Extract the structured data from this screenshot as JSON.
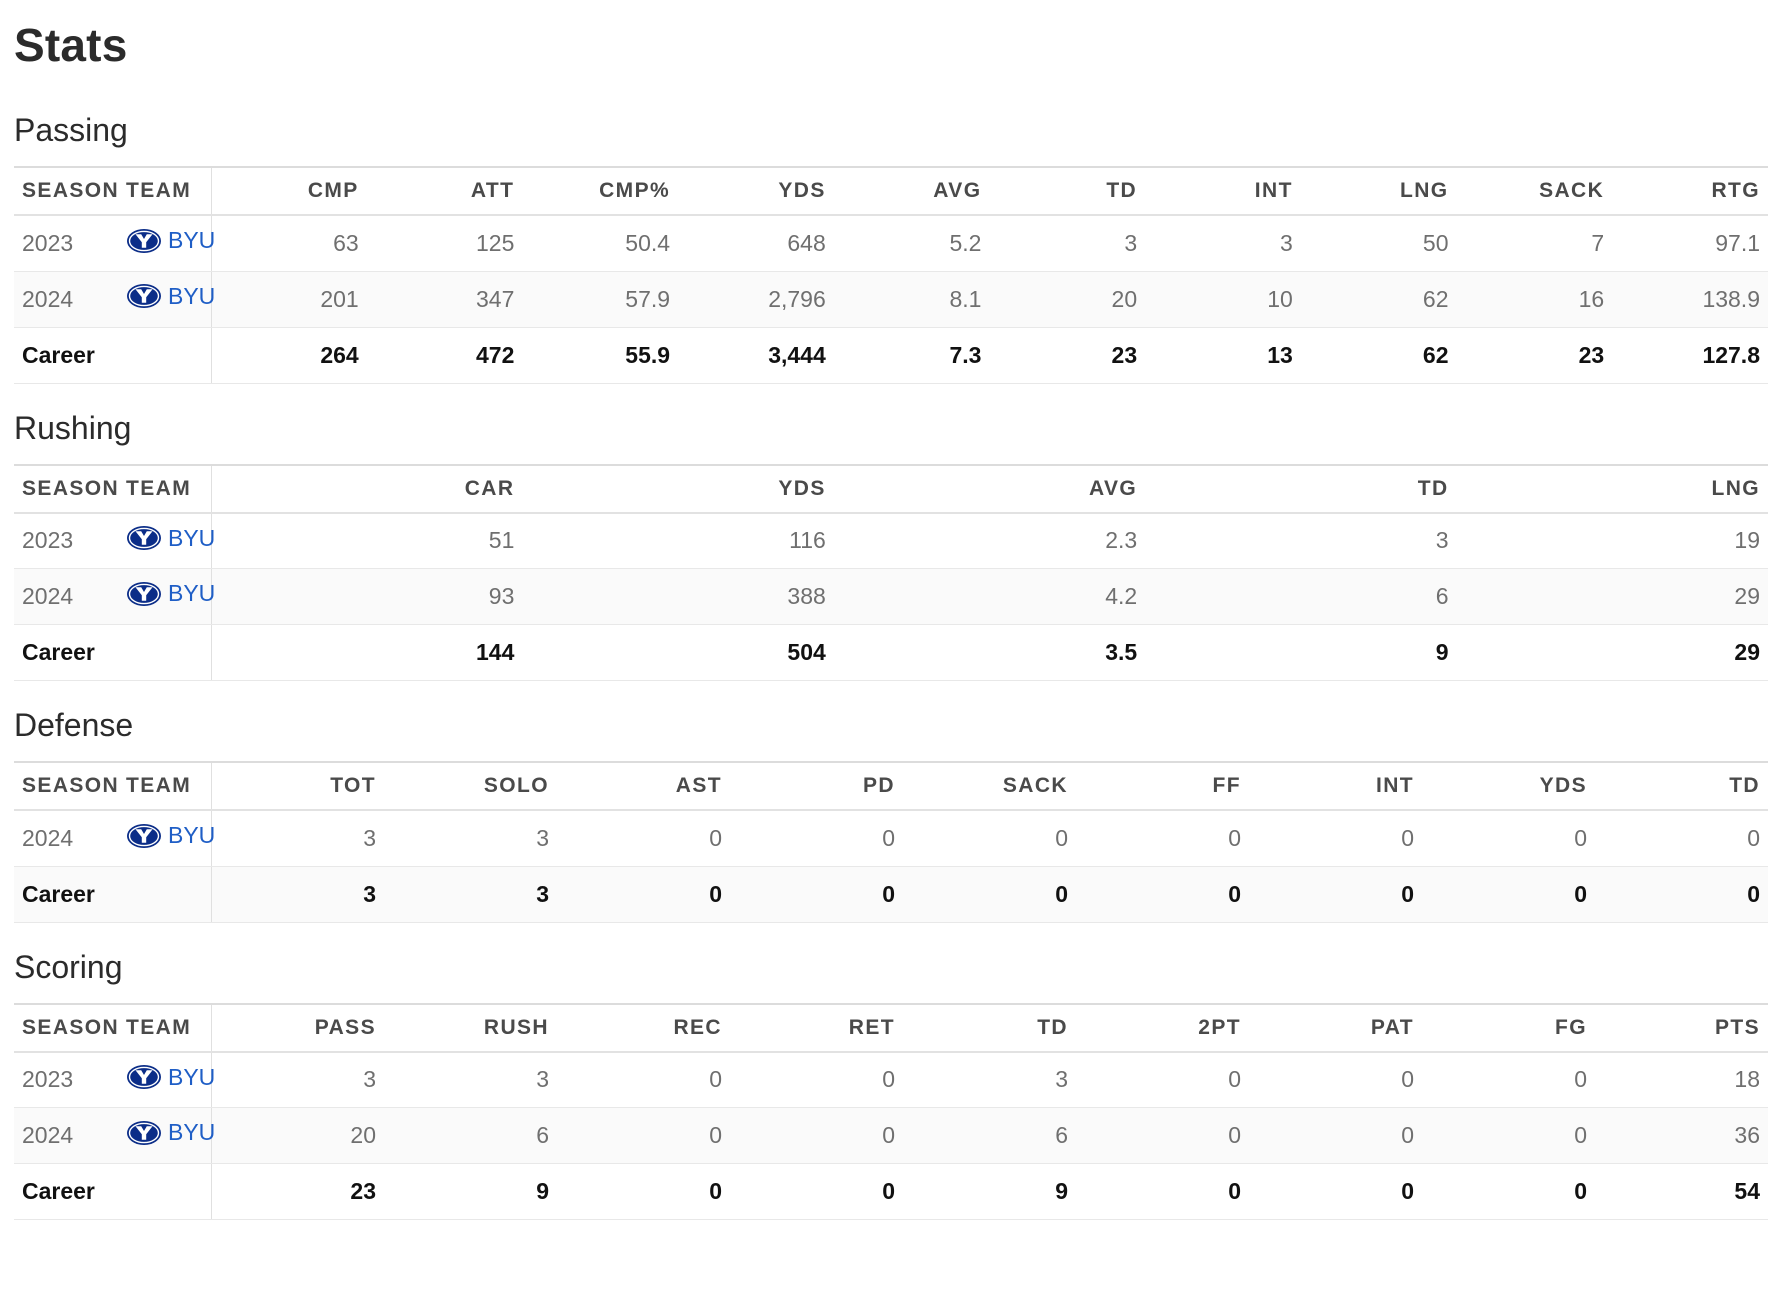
{
  "page": {
    "title": "Stats"
  },
  "team_logo": {
    "icon": "byu-logo-icon",
    "color": "#0b2d88"
  },
  "sections": [
    {
      "key": "passing",
      "title": "Passing",
      "headers": [
        "SEASON",
        "TEAM",
        "CMP",
        "ATT",
        "CMP%",
        "YDS",
        "AVG",
        "TD",
        "INT",
        "LNG",
        "SACK",
        "RTG"
      ],
      "rows": [
        {
          "season": "2023",
          "team": "BYU",
          "values": [
            "63",
            "125",
            "50.4",
            "648",
            "5.2",
            "3",
            "3",
            "50",
            "7",
            "97.1"
          ]
        },
        {
          "season": "2024",
          "team": "BYU",
          "values": [
            "201",
            "347",
            "57.9",
            "2,796",
            "8.1",
            "20",
            "10",
            "62",
            "16",
            "138.9"
          ]
        }
      ],
      "career": {
        "label": "Career",
        "values": [
          "264",
          "472",
          "55.9",
          "3,444",
          "7.3",
          "23",
          "13",
          "62",
          "23",
          "127.8"
        ]
      }
    },
    {
      "key": "rushing",
      "title": "Rushing",
      "headers": [
        "SEASON",
        "TEAM",
        "CAR",
        "YDS",
        "AVG",
        "TD",
        "LNG"
      ],
      "rows": [
        {
          "season": "2023",
          "team": "BYU",
          "values": [
            "51",
            "116",
            "2.3",
            "3",
            "19"
          ]
        },
        {
          "season": "2024",
          "team": "BYU",
          "values": [
            "93",
            "388",
            "4.2",
            "6",
            "29"
          ]
        }
      ],
      "career": {
        "label": "Career",
        "values": [
          "144",
          "504",
          "3.5",
          "9",
          "29"
        ]
      }
    },
    {
      "key": "defense",
      "title": "Defense",
      "headers": [
        "SEASON",
        "TEAM",
        "TOT",
        "SOLO",
        "AST",
        "PD",
        "SACK",
        "FF",
        "INT",
        "YDS",
        "TD"
      ],
      "rows": [
        {
          "season": "2024",
          "team": "BYU",
          "values": [
            "3",
            "3",
            "0",
            "0",
            "0",
            "0",
            "0",
            "0",
            "0"
          ]
        }
      ],
      "career": {
        "label": "Career",
        "values": [
          "3",
          "3",
          "0",
          "0",
          "0",
          "0",
          "0",
          "0",
          "0"
        ]
      }
    },
    {
      "key": "scoring",
      "title": "Scoring",
      "headers": [
        "SEASON",
        "TEAM",
        "PASS",
        "RUSH",
        "REC",
        "RET",
        "TD",
        "2PT",
        "PAT",
        "FG",
        "PTS"
      ],
      "rows": [
        {
          "season": "2023",
          "team": "BYU",
          "values": [
            "3",
            "3",
            "0",
            "0",
            "3",
            "0",
            "0",
            "0",
            "18"
          ]
        },
        {
          "season": "2024",
          "team": "BYU",
          "values": [
            "20",
            "6",
            "0",
            "0",
            "6",
            "0",
            "0",
            "0",
            "36"
          ]
        }
      ],
      "career": {
        "label": "Career",
        "values": [
          "23",
          "9",
          "0",
          "0",
          "9",
          "0",
          "0",
          "0",
          "54"
        ]
      }
    }
  ]
}
